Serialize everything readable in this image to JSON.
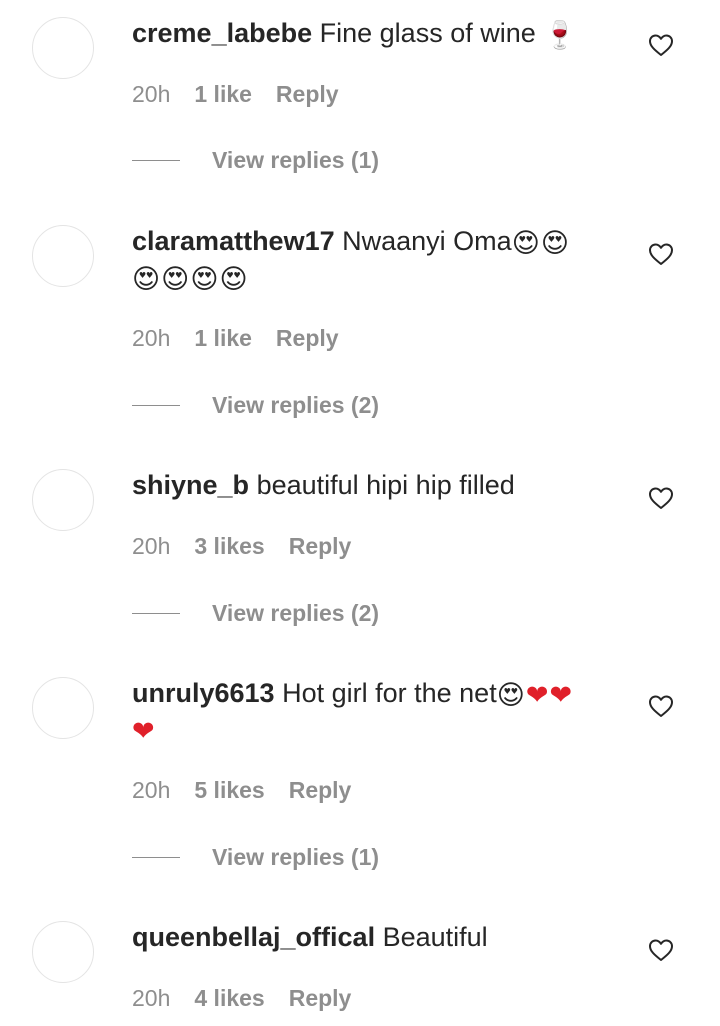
{
  "comments": [
    {
      "username": "creme_labebe",
      "text": "Fine glass of wine ",
      "emoji": [
        "🍷"
      ],
      "time": "20h",
      "likes": "1 like",
      "reply_label": "Reply",
      "view_replies": "View replies (1)"
    },
    {
      "username": "claramatthew17",
      "text": "Nwaanyi Oma",
      "emoji": [
        "😍",
        "😍",
        "😍",
        "😍",
        "😍",
        "😍"
      ],
      "time": "20h",
      "likes": "1 like",
      "reply_label": "Reply",
      "view_replies": "View replies (2)"
    },
    {
      "username": "shiyne_b",
      "text": "beautiful hipi hip filled",
      "emoji": [],
      "time": "20h",
      "likes": "3 likes",
      "reply_label": "Reply",
      "view_replies": "View replies (2)"
    },
    {
      "username": "unruly6613",
      "text": "Hot girl for the net",
      "emoji": [
        "😍",
        "❤",
        "❤",
        "❤"
      ],
      "time": "20h",
      "likes": "5 likes",
      "reply_label": "Reply",
      "view_replies": "View replies (1)"
    },
    {
      "username": "queenbellaj_offical",
      "text": "Beautiful",
      "emoji": [],
      "time": "20h",
      "likes": "4 likes",
      "reply_label": "Reply",
      "view_replies": ""
    }
  ],
  "icons": {
    "like": "heart-outline-icon",
    "avatar": "avatar-placeholder"
  },
  "colors": {
    "text_primary": "#262626",
    "text_secondary": "#8e8e8e",
    "avatar_border": "#e4e4e4",
    "heart_red": "#e0202a"
  }
}
